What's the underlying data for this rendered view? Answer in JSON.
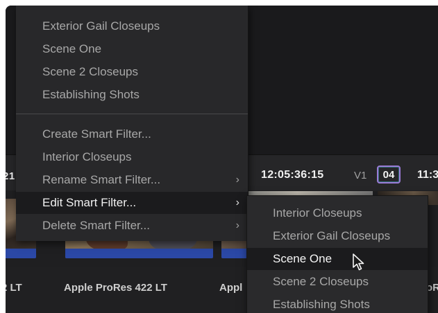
{
  "timeline": {
    "left_timecode_fragment": "21",
    "timecode": "12:05:36:15",
    "track": "V1",
    "track_badge": "04",
    "right_timecode_fragment": "11:3"
  },
  "clip_labels": [
    "2 LT",
    "Apple ProRes 422 LT",
    "Appl",
    "oR"
  ],
  "menu": {
    "items": [
      {
        "label": "Exterior Gail Closeups",
        "submenu": false
      },
      {
        "label": "Scene One",
        "submenu": false
      },
      {
        "label": "Scene 2 Closeups",
        "submenu": false
      },
      {
        "label": "Establishing Shots",
        "submenu": false
      },
      {
        "label": "Create Smart Filter...",
        "submenu": false
      },
      {
        "label": "Interior Closeups",
        "submenu": false
      },
      {
        "label": "Rename Smart Filter...",
        "submenu": true
      },
      {
        "label": "Edit Smart Filter...",
        "submenu": true,
        "highlighted": true
      },
      {
        "label": "Delete Smart Filter...",
        "submenu": true
      }
    ],
    "chevron_icon": "chevron-right-icon"
  },
  "submenu": {
    "items": [
      {
        "label": "Interior Closeups"
      },
      {
        "label": "Exterior Gail Closeups"
      },
      {
        "label": "Scene One",
        "selected": true
      },
      {
        "label": "Scene 2 Closeups"
      },
      {
        "label": "Establishing Shots"
      }
    ]
  },
  "colors": {
    "background": "#1c1c1e",
    "menu_bg": "#28282a",
    "highlight_bg": "#1b1b1d",
    "text_dim": "#a8a8a8",
    "text_bright": "#f2f2f2",
    "badge_border": "#9b7bd6",
    "clip_bar": "#2b48a6"
  }
}
